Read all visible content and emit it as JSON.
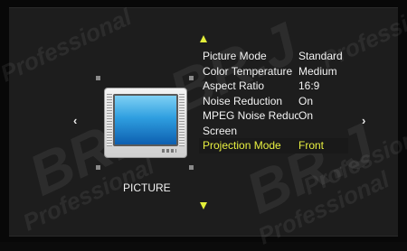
{
  "watermark": {
    "text_big": "BR.J",
    "text_small": "Professional"
  },
  "nav": {
    "left": "‹",
    "right": "›"
  },
  "preview": {
    "label": "PICTURE"
  },
  "menu": {
    "items": [
      {
        "label": "Picture Mode",
        "value": "Standard"
      },
      {
        "label": "Color Temperature",
        "value": "Medium"
      },
      {
        "label": "Aspect Ratio",
        "value": "16:9"
      },
      {
        "label": "Noise Reduction",
        "value": "On"
      },
      {
        "label": "MPEG  Noise Reducti",
        "value": "On"
      },
      {
        "label": "Screen",
        "value": ""
      },
      {
        "label": "Projection Mode",
        "value": "Front"
      }
    ],
    "selected_index": 6
  },
  "colors": {
    "highlight": "#e8f040",
    "text": "#f3f3f3",
    "background": "#1d1d1d"
  }
}
